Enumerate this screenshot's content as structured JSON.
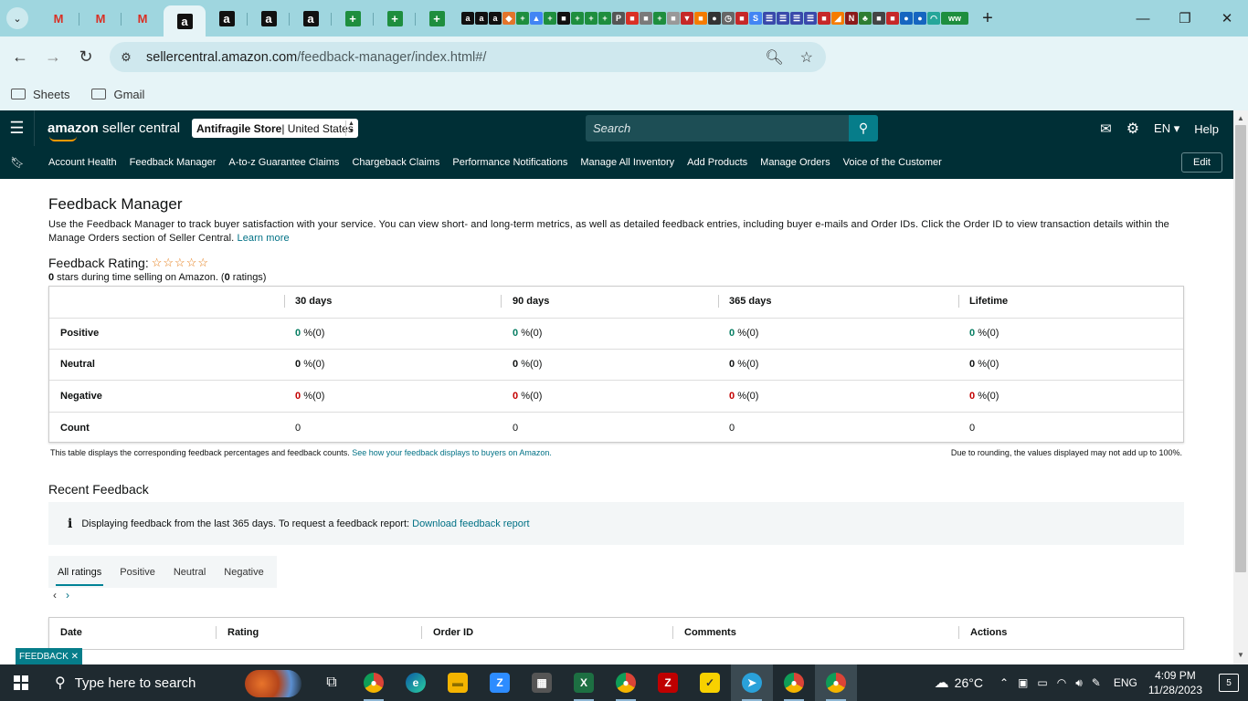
{
  "browser": {
    "url_host": "sellercentral.amazon.com",
    "url_path": "/feedback-manager/index.html#/",
    "bookmarks": [
      "Sheets",
      "Gmail"
    ]
  },
  "header": {
    "logo_brand": "amazon",
    "logo_rest": " seller central",
    "store_name": "Antifragile Store",
    "store_region": " | United States",
    "search_placeholder": "Search",
    "language": "EN",
    "help": "Help"
  },
  "subnav": {
    "items": [
      "Account Health",
      "Feedback Manager",
      "A-to-z Guarantee Claims",
      "Chargeback Claims",
      "Performance Notifications",
      "Manage All Inventory",
      "Add Products",
      "Manage Orders",
      "Voice of the Customer"
    ],
    "edit": "Edit"
  },
  "page": {
    "title": "Feedback Manager",
    "intro": "Use the Feedback Manager to track buyer satisfaction with your service. You can view short- and long-term metrics, as well as detailed feedback entries, including buyer e-mails and Order IDs. Click the Order ID to view transaction details within the Manage Orders section of Seller Central. ",
    "learn_more": "Learn more",
    "rating_label": "Feedback Rating:",
    "rating_stars": 0,
    "stars_value": "0",
    "stars_text": " stars during time selling on Amazon. (",
    "ratings_count": "0",
    "ratings_text": " ratings)"
  },
  "metrics": {
    "columns": [
      "30 days",
      "90 days",
      "365 days",
      "Lifetime"
    ],
    "rows": [
      {
        "label": "Positive",
        "values": [
          "0",
          "0",
          "0",
          "0"
        ],
        "suffix": [
          "%(0)",
          "%(0)",
          "%(0)",
          "%(0)"
        ]
      },
      {
        "label": "Neutral",
        "values": [
          "0",
          "0",
          "0",
          "0"
        ],
        "suffix": [
          "%(0)",
          "%(0)",
          "%(0)",
          "%(0)"
        ]
      },
      {
        "label": "Negative",
        "values": [
          "0",
          "0",
          "0",
          "0"
        ],
        "suffix": [
          "%(0)",
          "%(0)",
          "%(0)",
          "%(0)"
        ]
      },
      {
        "label": "Count",
        "values": [
          "0",
          "0",
          "0",
          "0"
        ],
        "suffix": [
          "",
          "",
          "",
          ""
        ]
      }
    ],
    "note_left": "This table displays the corresponding feedback percentages and feedback counts. ",
    "note_link": "See how your feedback displays to buyers on Amazon.",
    "note_right": "Due to rounding, the values displayed may not add up to 100%."
  },
  "recent": {
    "title": "Recent Feedback",
    "info_text": "Displaying feedback from the last 365 days. To request a feedback report: ",
    "info_link": "Download feedback report",
    "tabs": [
      "All ratings",
      "Positive",
      "Neutral",
      "Negative"
    ],
    "table_headers": [
      "Date",
      "Rating",
      "Order ID",
      "Comments",
      "Actions"
    ]
  },
  "feedback_button": "FEEDBACK ✕",
  "taskbar": {
    "search_placeholder": "Type here to search",
    "weather": "26°C",
    "lang": "ENG",
    "time": "4:09 PM",
    "date": "11/28/2023",
    "notif_count": "5"
  },
  "colors": {
    "header_bg": "#002f36",
    "accent": "#008296",
    "positive": "#067d62",
    "negative": "#c40000",
    "link": "#007185"
  }
}
